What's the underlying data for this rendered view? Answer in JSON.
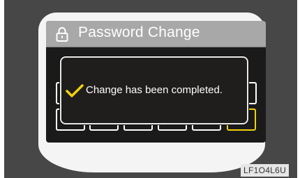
{
  "screen": {
    "title": "Password Change",
    "icon": "lock-icon",
    "pin_fields": [
      {
        "slot": 1,
        "selected": false
      },
      {
        "slot": 2,
        "selected": false
      },
      {
        "slot": 3,
        "selected": false
      },
      {
        "slot": 4,
        "selected": false
      },
      {
        "slot": 5,
        "selected": false
      },
      {
        "slot": 6,
        "selected": true
      }
    ]
  },
  "dialog": {
    "icon": "checkmark-icon",
    "message": "Change has been completed."
  },
  "figure_code": "LF1O4L6U",
  "colors": {
    "background": "#474747",
    "bezel": "#f4f4f4",
    "screen": "#1a1a1a",
    "titlebar": "#a8a8a8",
    "accent": "#f2d10c"
  }
}
